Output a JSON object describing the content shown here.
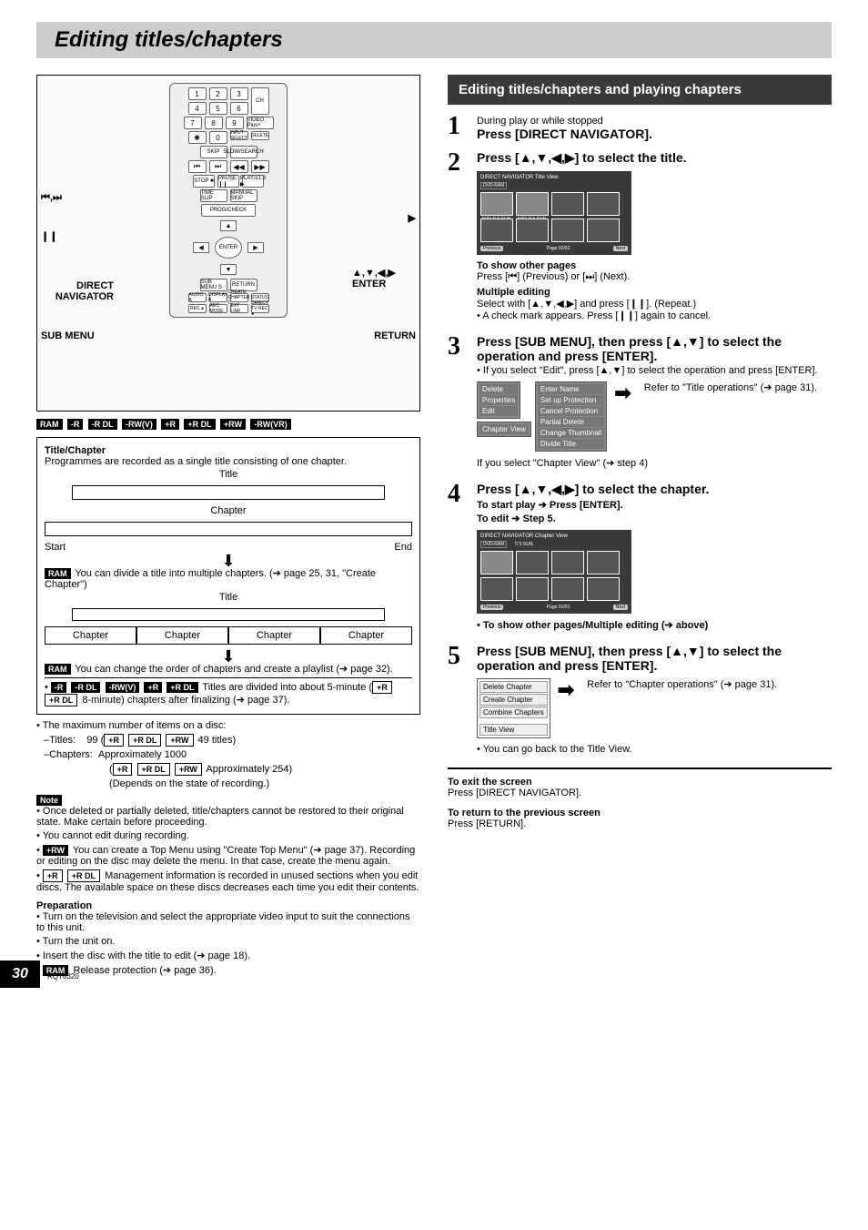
{
  "page_title": "Editing titles/chapters",
  "page_number": "30",
  "manual_code": "RQT8320",
  "remote": {
    "label_skip_prev": "⏮,⏭",
    "label_pause": "❙❙",
    "label_direct_navigator": "DIRECT NAVIGATOR",
    "label_submenu": "SUB MENU",
    "label_play": "▶",
    "label_arrows_enter": "▲,▼,◀,▶ ENTER",
    "label_return": "RETURN",
    "keys": {
      "digits": [
        "1",
        "2",
        "3",
        "4",
        "5",
        "6",
        "7",
        "8",
        "9",
        "✱",
        "0"
      ],
      "ch": "CH",
      "video_plus": "VIDEO Plus+",
      "input_select": "INPUT SELECT",
      "delete": "DELETE",
      "skip": "SKIP",
      "slow": "SLOW/SEARCH",
      "skip_prev": "⏮",
      "skip_next": "⏭",
      "rew": "◀◀",
      "ff": "▶▶",
      "stop": "STOP ■",
      "pause": "PAUSE ❙❙",
      "play": "PLAY/x1.3 ▶",
      "time_slip": "TIME SLIP",
      "manual_skip": "MANUAL SKIP",
      "prog_check": "PROG/CHECK",
      "direct_nav": "DIRECT NAVIGATOR",
      "enter": "ENTER",
      "submenu": "SUB MENU S",
      "return": "RETURN",
      "audio": "AUDIO A",
      "display": "DISPLAY B",
      "create_chapter": "CREATE CHAPTER C",
      "status": "STATUS",
      "rec": "REC ●",
      "rec_mode": "REC MODE",
      "ext_link": "EXT LINK",
      "directv": "DIRECT TV REC ●"
    }
  },
  "format_badges": [
    "RAM",
    "-R",
    "-R DL",
    "-RW(V)",
    "+R",
    "+R DL",
    "+RW",
    "-RW(VR)"
  ],
  "title_chapter": {
    "heading": "Title/Chapter",
    "desc": "Programmes are recorded as a single title consisting of one chapter.",
    "title_label": "Title",
    "chapter_label": "Chapter",
    "start": "Start",
    "end": "End",
    "divide_note": "You can divide a title into multiple chapters. (➔ page 25, 31, \"Create Chapter\")",
    "reorder_note": "You can change the order of chapters and create a playlist (➔ page 32).",
    "chapters4": [
      "Chapter",
      "Chapter",
      "Chapter",
      "Chapter"
    ],
    "finalize_badges1": [
      "-R",
      "-R DL",
      "-RW(V)",
      "+R",
      "+R DL"
    ],
    "finalize_badges2": [
      "+R",
      "+R DL"
    ],
    "finalize_text1": "Titles are divided into about 5-minute (",
    "finalize_text2": " 8-minute) chapters after finalizing (➔ page 37).",
    "max_items": "The maximum number of items on a disc:",
    "titles_row": "–Titles:",
    "titles_val": "99 (",
    "titles_badges": [
      "+R",
      "+R DL",
      "+RW"
    ],
    "titles_val2": " 49 titles)",
    "chapters_row": "–Chapters:",
    "chapters_val1": "Approximately 1000",
    "chapters_val2_badges": [
      "+R",
      "+R DL",
      "+RW"
    ],
    "chapters_val2": " Approximately 254)",
    "chapters_val3": "(Depends on the state of recording.)"
  },
  "note": {
    "label": "Note",
    "items": [
      "Once deleted or partially deleted, title/chapters cannot be restored to their original state. Make certain before proceeding.",
      "You cannot edit during recording."
    ],
    "rw_badge": "+RW",
    "rw_text": "You can create a Top Menu using \"Create Top Menu\" (➔ page 37). Recording or editing on the disc may delete the menu. In that case, create the menu again.",
    "rl_badges": [
      "+R",
      "+R DL"
    ],
    "rl_text": "Management information is recorded in unused sections when you edit discs. The available space on these discs decreases each time you edit their contents."
  },
  "preparation": {
    "heading": "Preparation",
    "items": [
      "Turn on the television and select the appropriate video input to suit the connections to this unit.",
      "Turn the unit on.",
      "Insert the disc with the title to edit (➔ page 18)."
    ],
    "ram_badge": "RAM",
    "ram_text": "Release protection (➔ page 36)."
  },
  "right": {
    "header": "Editing titles/chapters and playing chapters",
    "step1": {
      "pre": "During play or while stopped",
      "main": "Press [DIRECT NAVIGATOR]."
    },
    "step2": {
      "main": "Press [▲,▼,◀,▶] to select the title.",
      "screen": {
        "title": "DIRECT NAVIGATOR   Title View",
        "disc": "DVD-RAM",
        "t1": "ARD   7/ 5 SUN",
        "t2": "ARD   7/ 5 SUN",
        "prev": "Previous",
        "page": "Page  02/02",
        "next": "Next"
      },
      "tips": {
        "show_pages": "To show other pages",
        "show_pages_body": "Press [⏮] (Previous) or [⏭] (Next).",
        "multi": "Multiple editing",
        "multi_body": "Select with [▲,▼,◀,▶] and press [❙❙]. (Repeat.)",
        "multi_body2": "• A check mark appears. Press [❙❙] again to cancel."
      }
    },
    "step3": {
      "main": "Press [SUB MENU], then press [▲,▼] to select the operation and press [ENTER].",
      "sub": "• If you select \"Edit\", press [▲,▼] to select the operation and press [ENTER].",
      "menu_left": [
        "Delete",
        "Properties",
        "Edit"
      ],
      "menu_left2": "Chapter View",
      "menu_right": [
        "Enter Name",
        "Set up Protection",
        "Cancel Protection",
        "Partial Delete",
        "Change Thumbnail",
        "Divide Title"
      ],
      "refer": "Refer to \"Title operations\" (➔ page 31).",
      "after": "If you select \"Chapter View\" (➔ step 4)"
    },
    "step4": {
      "main": "Press [▲,▼,◀,▶] to select the chapter.",
      "sub1": "To start play ➔ Press [ENTER].",
      "sub2": "To edit ➔ Step 5.",
      "screen": {
        "title": "DIRECT NAVIGATOR   Chapter View",
        "disc": "DVD-RAM",
        "info": "7/ 5 SUN",
        "prev": "Previous",
        "page": "Page  01/01",
        "next": "Next"
      },
      "after": "• To show other pages/Multiple editing (➔ above)"
    },
    "step5": {
      "main": "Press [SUB MENU], then press [▲,▼] to select the operation and press [ENTER].",
      "menu": [
        "Delete Chapter",
        "Create Chapter",
        "Combine Chapters",
        "Title View"
      ],
      "refer": "Refer to \"Chapter operations\" (➔ page 31).",
      "after": "• You can go back to the Title View."
    },
    "exit": {
      "h": "To exit the screen",
      "b": "Press [DIRECT NAVIGATOR]."
    },
    "return": {
      "h": "To return to the previous screen",
      "b": "Press [RETURN]."
    }
  }
}
